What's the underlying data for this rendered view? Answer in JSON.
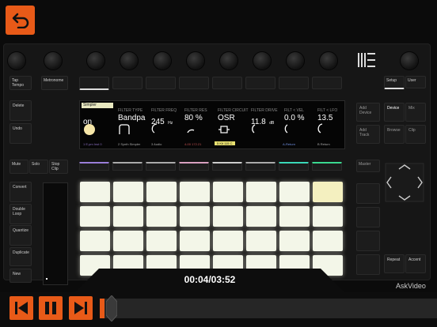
{
  "video": {
    "time_display": "00:04/03:52",
    "watermark": "AskVideo"
  },
  "device": {
    "left_buttons": [
      "Tap Tempo",
      "Metronome",
      "Delete",
      "Undo",
      "Mute",
      "Solo",
      "Stop Clip",
      "Convert",
      "Double Loop",
      "Quantize",
      "Duplicate",
      "New"
    ],
    "right_buttons": [
      "Setup",
      "User",
      "Add Device",
      "Add Track",
      "Device",
      "Mix",
      "Browse",
      "Clip",
      "Master",
      "Repeat",
      "Accent"
    ],
    "screen": {
      "tab": "Simpler",
      "params": [
        {
          "header": "",
          "value": "on",
          "sub": "1 E.pm Inst 0"
        },
        {
          "header": "FILTER TYPE",
          "value": "Bandpa",
          "sub": "2 Synth Simpler"
        },
        {
          "header": "FILTER FREQ",
          "value": "245",
          "unit": "Hz",
          "sub": "3 Audio"
        },
        {
          "header": "FILTER RES",
          "value": "80 %",
          "sub": "4-00 172.21"
        },
        {
          "header": "FILTER CIRCUIT",
          "value": "OSR",
          "sub": "5 Kit 115 C"
        },
        {
          "header": "FILTER DRIVE",
          "value": "11.8",
          "unit": "dB",
          "sub": ""
        },
        {
          "header": "FILT < VEL",
          "value": "0.0 %",
          "sub": "A-Return"
        },
        {
          "header": "FILT < LFO",
          "value": "13.5",
          "sub": "B Return"
        }
      ]
    }
  },
  "colors": {
    "accent": "#e85a18"
  }
}
